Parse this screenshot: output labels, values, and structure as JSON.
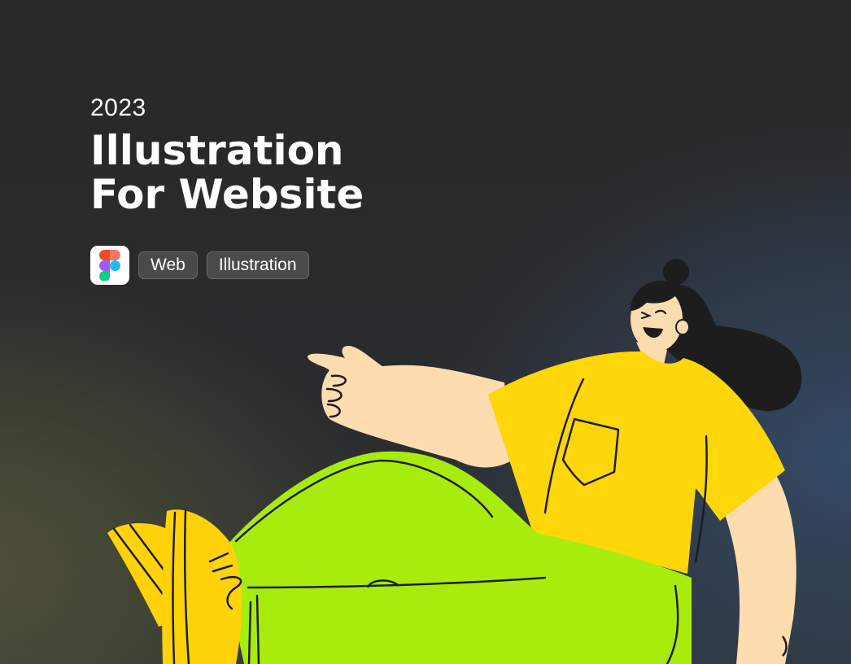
{
  "header": {
    "year": "2023",
    "title_line1": "Illustration",
    "title_line2": "For Website"
  },
  "tags": [
    {
      "label": "Web"
    },
    {
      "label": "Illustration"
    }
  ],
  "icons": {
    "tool_logo": "figma-icon"
  },
  "colors": {
    "shirt": "#ffd60a",
    "pants": "#a8ec0e",
    "skin": "#fddcb0",
    "hair": "#1d1d1d",
    "shoe": "#ffd20a"
  }
}
